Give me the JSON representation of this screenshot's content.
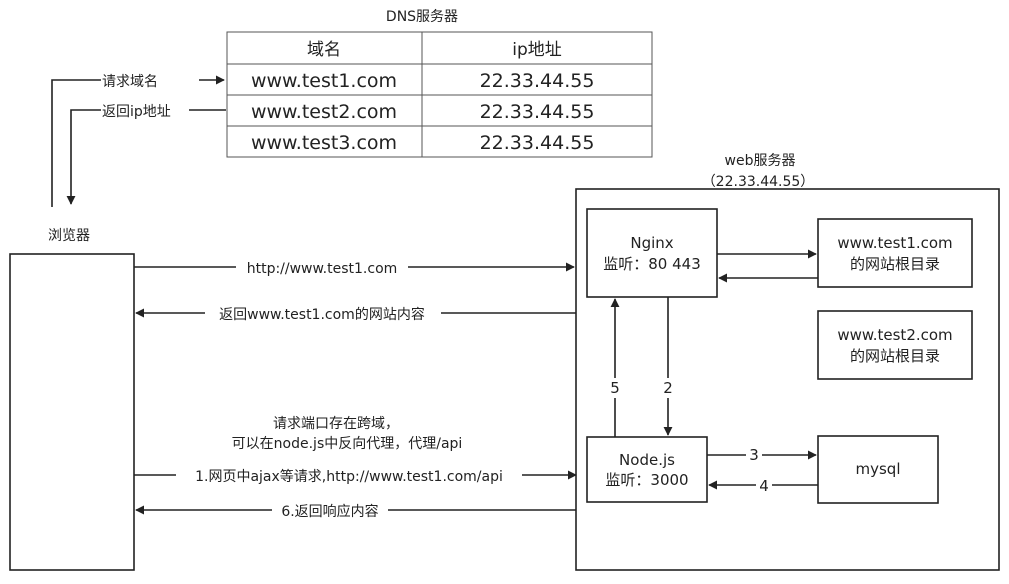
{
  "dns": {
    "title": "DNS服务器",
    "headers": [
      "域名",
      "ip地址"
    ],
    "rows": [
      [
        "www.test1.com",
        "22.33.44.55"
      ],
      [
        "www.test2.com",
        "22.33.44.55"
      ],
      [
        "www.test3.com",
        "22.33.44.55"
      ]
    ]
  },
  "browser": {
    "label": "浏览器"
  },
  "dns_flow": {
    "request": "请求域名",
    "response": "返回ip地址"
  },
  "web_server": {
    "title": "web服务器",
    "ip": "（22.33.44.55）"
  },
  "nginx": {
    "name": "Nginx",
    "listen": "监听：80 443"
  },
  "site1": {
    "line1": "www.test1.com",
    "line2": "的网站根目录"
  },
  "site2": {
    "line1": "www.test2.com",
    "line2": "的网站根目录"
  },
  "node": {
    "name": "Node.js",
    "listen": "监听：3000"
  },
  "mysql": {
    "name": "mysql"
  },
  "flows": {
    "http_request": "http://www.test1.com",
    "return_site": "返回www.test1.com的网站内容",
    "cors_note_1": "请求端口存在跨域，",
    "cors_note_2": "可以在node.js中反向代理，代理/api",
    "ajax_request": "1.网页中ajax等请求,http://www.test1.com/api",
    "return_response": "6.返回响应内容",
    "step_2": "2",
    "step_3": "3",
    "step_4": "4",
    "step_5": "5"
  }
}
